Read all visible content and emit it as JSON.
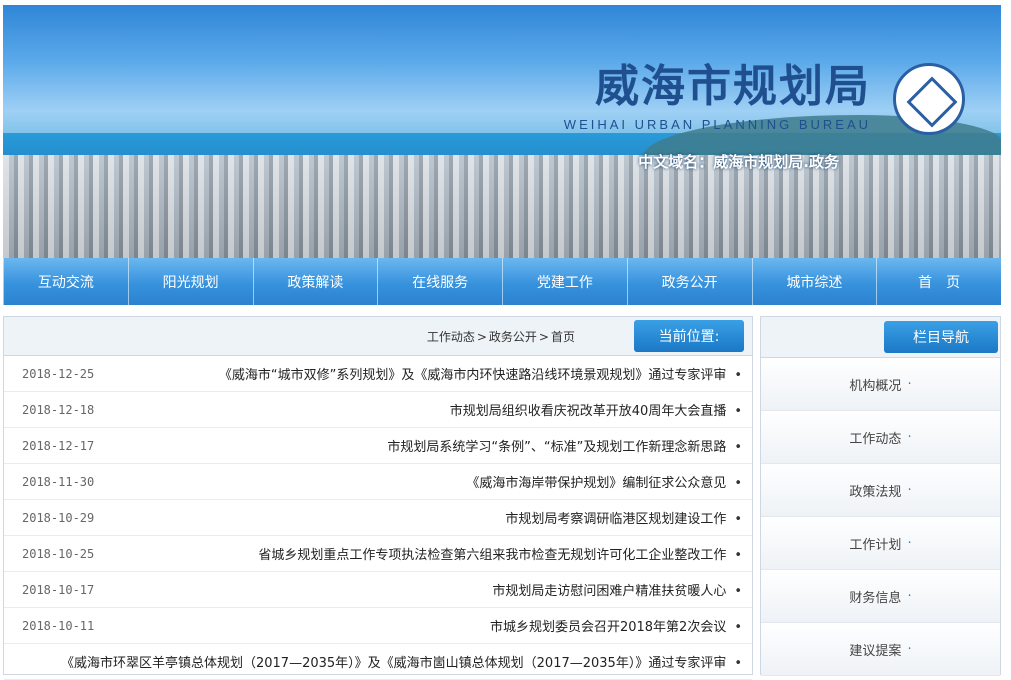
{
  "header": {
    "title_cn": "威海市规划局",
    "title_en": "WEIHAI URBAN PLANNING BUREAU",
    "domain_label": "中文域名：威海市规划局.政务"
  },
  "nav": {
    "items": [
      {
        "label": "首　页"
      },
      {
        "label": "城市综述"
      },
      {
        "label": "政务公开"
      },
      {
        "label": "党建工作"
      },
      {
        "label": "在线服务"
      },
      {
        "label": "政策解读"
      },
      {
        "label": "阳光规划"
      },
      {
        "label": "互动交流"
      }
    ]
  },
  "breadcrumb": {
    "label": "当前位置:",
    "home": "首页",
    "sep": ">",
    "section": "政务公开",
    "page": "工作动态"
  },
  "news": [
    {
      "title": "《威海市“城市双修”系列规划》及《威海市内环快速路沿线环境景观规划》通过专家评审",
      "date": "2018-12-25"
    },
    {
      "title": "市规划局组织收看庆祝改革开放40周年大会直播",
      "date": "2018-12-18"
    },
    {
      "title": "市规划局系统学习“条例”、“标准”及规划工作新理念新思路",
      "date": "2018-12-17"
    },
    {
      "title": "《威海市海岸带保护规划》编制征求公众意见",
      "date": "2018-11-30"
    },
    {
      "title": "市规划局考察调研临港区规划建设工作",
      "date": "2018-10-29"
    },
    {
      "title": "省城乡规划重点工作专项执法检查第六组来我市检查无规划许可化工企业整改工作",
      "date": "2018-10-25"
    },
    {
      "title": "市规划局走访慰问困难户精准扶贫暖人心",
      "date": "2018-10-17"
    },
    {
      "title": "市城乡规划委员会召开2018年第2次会议",
      "date": "2018-10-11"
    },
    {
      "title": "《威海市环翠区羊亭镇总体规划（2017—2035年）》及《威海市崮山镇总体规划（2017—2035年）》通过专家评审",
      "date": ""
    }
  ],
  "sidebar": {
    "title": "栏目导航",
    "items": [
      {
        "label": "机构概况"
      },
      {
        "label": "工作动态"
      },
      {
        "label": "政策法规"
      },
      {
        "label": "工作计划"
      },
      {
        "label": "财务信息"
      },
      {
        "label": "建议提案"
      }
    ]
  }
}
